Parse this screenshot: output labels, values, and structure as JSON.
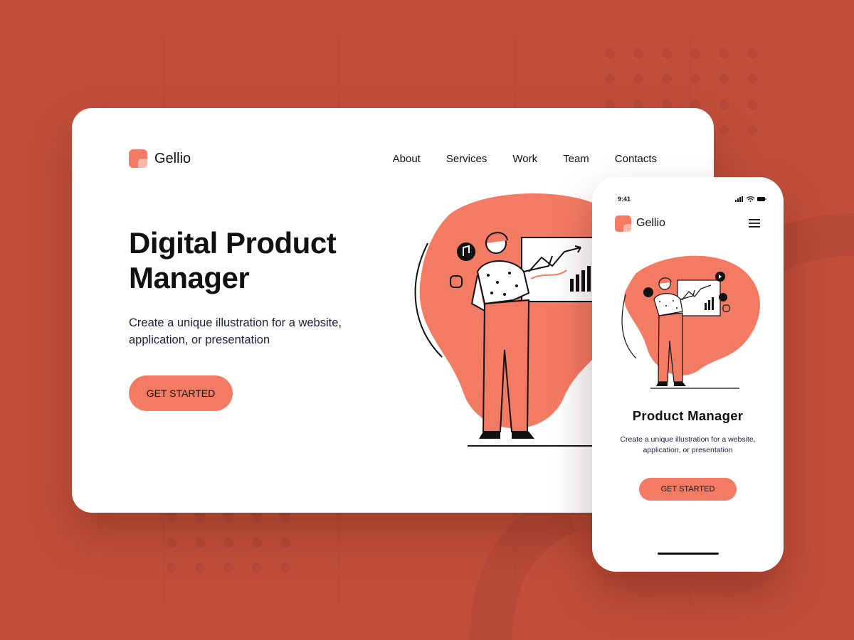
{
  "colors": {
    "background": "#c24f3b",
    "accent": "#f47b63",
    "accent_light": "#ffb8a8",
    "card": "#ffffff",
    "text": "#111111"
  },
  "desktop": {
    "brand": "Gellio",
    "nav": [
      "About",
      "Services",
      "Work",
      "Team",
      "Contacts"
    ],
    "title": "Digital Product Manager",
    "subtitle": "Create a unique illustration for a website, application, or presentation",
    "cta": "GET STARTED",
    "illustration": "person-presenting-chart-illustration"
  },
  "mobile": {
    "time": "9:41",
    "status_icons": [
      "signal-icon",
      "wifi-icon",
      "battery-icon"
    ],
    "brand": "Gellio",
    "menu_icon": "hamburger-icon",
    "title": "Product Manager",
    "subtitle": "Create a unique illustration for a website, application, or presentation",
    "cta": "GET STARTED",
    "illustration": "person-presenting-chart-illustration"
  }
}
